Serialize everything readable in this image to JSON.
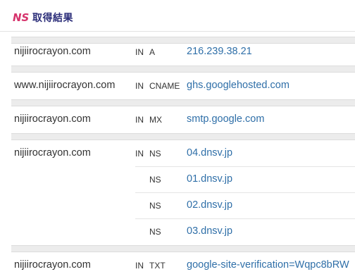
{
  "header": {
    "logo_text": "NS",
    "title": "取得結果"
  },
  "records": [
    {
      "host": "nijiirocrayon.com",
      "class": "IN",
      "type": "A",
      "value": "216.239.38.21"
    },
    {
      "host": "www.nijiirocrayon.com",
      "class": "IN",
      "type": "CNAME",
      "value": "ghs.googlehosted.com"
    },
    {
      "host": "nijiirocrayon.com",
      "class": "IN",
      "type": "MX",
      "value": "smtp.google.com"
    },
    {
      "host": "nijiirocrayon.com",
      "class": "IN",
      "type": "NS",
      "value": "04.dnsv.jp"
    },
    {
      "host": "",
      "class": "",
      "type": "NS",
      "value": "01.dnsv.jp"
    },
    {
      "host": "",
      "class": "",
      "type": "NS",
      "value": "02.dnsv.jp"
    },
    {
      "host": "",
      "class": "",
      "type": "NS",
      "value": "03.dnsv.jp"
    },
    {
      "host": "nijiirocrayon.com",
      "class": "IN",
      "type": "TXT",
      "value": "google-site-verification=Wqpc8bRW"
    }
  ]
}
